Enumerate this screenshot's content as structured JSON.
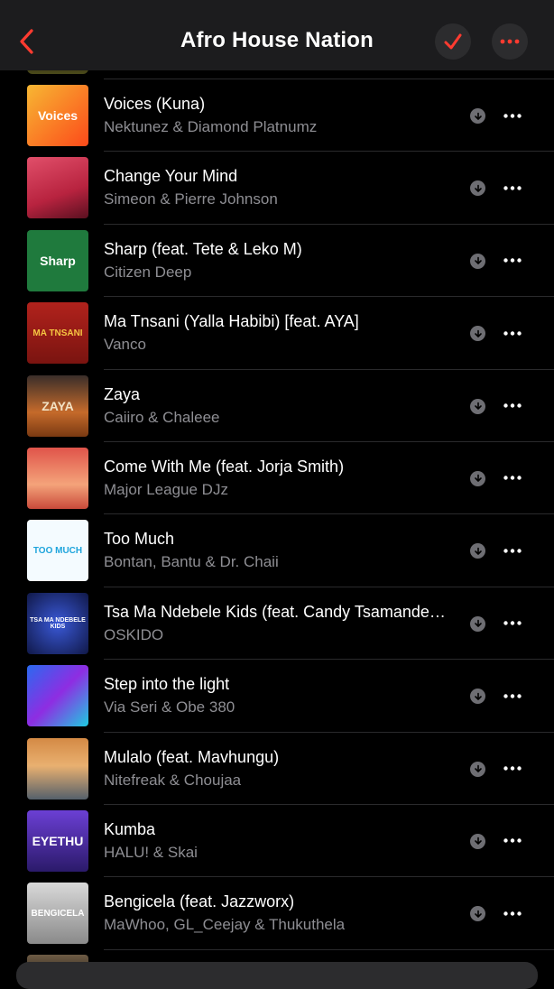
{
  "header": {
    "title": "Afro House Nation",
    "back_icon": "chevron-left-icon",
    "check_icon": "checkmark-icon",
    "more_icon": "ellipsis-icon",
    "accent_color": "#ff3b30"
  },
  "tracks": [
    {
      "title": "Voices (Kuna)",
      "artist": "Nektunez & Diamond Platnumz",
      "art_text": "Voices",
      "art_bg": "linear-gradient(135deg,#f7b733,#fc4a1a)",
      "art_color": "#ffffff"
    },
    {
      "title": "Change Your Mind",
      "artist": "Simeon & Pierre Johnson",
      "art_text": "",
      "art_bg": "linear-gradient(160deg,#e14f6a,#b8233f 60%,#5a1020)",
      "art_color": "#ffffff"
    },
    {
      "title": "Sharp (feat. Tete & Leko M)",
      "artist": "Citizen Deep",
      "art_text": "Sharp",
      "art_bg": "#1f7a3d",
      "art_color": "#ffffff"
    },
    {
      "title": "Ma Tnsani (Yalla Habibi) [feat. AYA]",
      "artist": "Vanco",
      "art_text": "MA TNSANI",
      "art_bg": "linear-gradient(#b1221c,#7a1410)",
      "art_color": "#f5c542"
    },
    {
      "title": "Zaya",
      "artist": "Caiiro & Chaleee",
      "art_text": "ZAYA",
      "art_bg": "linear-gradient(#3a2e2a,#c56a2b 60%,#7a3a12)",
      "art_color": "#f2e2c4"
    },
    {
      "title": "Come With Me (feat. Jorja Smith)",
      "artist": "Major League DJz",
      "art_text": "",
      "art_bg": "linear-gradient(#e0544a,#f4a37a 60%,#c94a3a)",
      "art_color": "#ffffff"
    },
    {
      "title": "Too Much",
      "artist": "Bontan, Bantu & Dr. Chaii",
      "art_text": "TOO MUCH",
      "art_bg": "#f4fbff",
      "art_color": "#1ea4dc"
    },
    {
      "title": "Tsa Ma Ndebele Kids (feat. Candy Tsamandebele)",
      "artist": "OSKIDO",
      "art_text": "TSA MA NDEBELE KIDS",
      "art_bg": "radial-gradient(circle,#3a59d8,#101848)",
      "art_color": "#ffffff"
    },
    {
      "title": "Step into the light",
      "artist": "Via Seri & Obe 380",
      "art_text": "",
      "art_bg": "linear-gradient(135deg,#2a6af0,#8e2de2 50%,#1ecbe1)",
      "art_color": "#ffffff"
    },
    {
      "title": "Mulalo (feat. Mavhungu)",
      "artist": "Nitefreak & Choujaa",
      "art_text": "",
      "art_bg": "linear-gradient(#d48a45,#e9b070 45%,#55606b)",
      "art_color": "#ffffff"
    },
    {
      "title": "Kumba",
      "artist": "HALU! & Skai",
      "art_text": "EYETHU",
      "art_bg": "linear-gradient(#6b3fd4,#2b1a6a)",
      "art_color": "#ffffff"
    },
    {
      "title": "Bengicela (feat. Jazzworx)",
      "artist": "MaWhoo, GL_Ceejay & Thukuthela",
      "art_text": "BENGICELA",
      "art_bg": "linear-gradient(#d9d9d9,#8a8a8a)",
      "art_color": "#ffffff"
    }
  ],
  "row_icons": {
    "download": "download-arrow-icon",
    "more": "ellipsis-icon"
  }
}
